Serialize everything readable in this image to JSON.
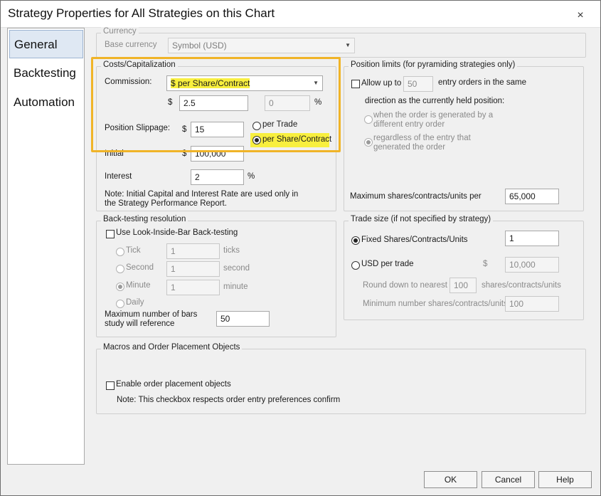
{
  "window": {
    "title": "Strategy Properties for All Strategies on this Chart",
    "close_glyph": "×"
  },
  "nav": {
    "items": [
      "General",
      "Backtesting",
      "Automation"
    ],
    "active": "General"
  },
  "currency": {
    "group_title": "Currency",
    "base_currency_label": "Base currency",
    "base_currency_value": "Symbol (USD)"
  },
  "costs": {
    "group_title": "Costs/Capitalization",
    "commission_label": "Commission:",
    "commission_value": "$ per Share/Contract",
    "commission_dollar_symbol": "$",
    "commission_amount": "2.5",
    "commission_percent": "0",
    "percent_symbol": "%",
    "slippage_label": "Position Slippage:",
    "slippage_dollar_symbol": "$",
    "slippage_value": "15",
    "per_trade_label": "per Trade",
    "per_share_label": "per Share/Contract",
    "initial_label": "Initial",
    "initial_dollar_symbol": "$",
    "initial_value": "100,000",
    "interest_label": "Interest",
    "interest_value": "2",
    "interest_percent_symbol": "%",
    "note_line1": "Note: Initial Capital and Interest Rate are used only in",
    "note_line2": "the Strategy Performance Report."
  },
  "position_limits": {
    "group_title": "Position limits (for pyramiding strategies only)",
    "allow_up_to_label": "Allow up to",
    "allow_up_to_value": "50",
    "entry_orders_label": "entry orders in the same",
    "direction_label": "direction as the currently held position:",
    "option1_line1": "when the order is generated by a",
    "option1_line2": "different entry order",
    "option2_line1": "regardless of the entry that",
    "option2_line2": "generated the order",
    "max_shares_label": "Maximum shares/contracts/units per",
    "max_shares_value": "65,000"
  },
  "backtesting_resolution": {
    "group_title": "Back-testing resolution",
    "lib_label": "Use Look-Inside-Bar Back-testing",
    "tick_label": "Tick",
    "tick_value": "1",
    "tick_unit": "ticks",
    "second_label": "Second",
    "second_value": "1",
    "second_unit": "second",
    "minute_label": "Minute",
    "minute_value": "1",
    "minute_unit": "minute",
    "daily_label": "Daily",
    "max_bars_line1": "Maximum number of bars",
    "max_bars_line2": "study will reference",
    "max_bars_value": "50"
  },
  "trade_size": {
    "group_title": "Trade size (if not specified by strategy)",
    "fixed_label": "Fixed Shares/Contracts/Units",
    "fixed_value": "1",
    "usd_label": "USD per trade",
    "usd_dollar_symbol": "$",
    "usd_value": "10,000",
    "round_label": "Round down to nearest",
    "round_value": "100",
    "round_unit": "shares/contracts/units",
    "min_label": "Minimum number shares/contracts/units:",
    "min_value": "100"
  },
  "macros": {
    "group_title": "Macros and Order Placement Objects",
    "enable_label": "Enable order placement objects",
    "note": "Note: This checkbox respects order entry preferences confirm"
  },
  "footer": {
    "ok_label": "OK",
    "cancel_label": "Cancel",
    "help_label": "Help"
  },
  "colors": {
    "highlight": "#f8ef3e",
    "callout_border": "#f0b428",
    "nav_active": "#dfe8f3"
  }
}
